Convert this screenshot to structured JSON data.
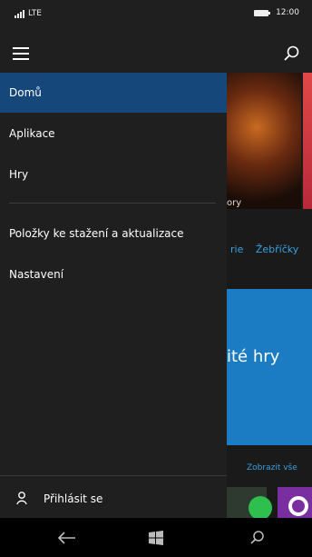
{
  "status_bar": {
    "network": "LTE",
    "time": "12:00"
  },
  "drawer": {
    "items": [
      {
        "label": "Domů",
        "active": true
      },
      {
        "label": "Aplikace"
      },
      {
        "label": "Hry"
      },
      {
        "label": "Položky ke stažení a aktualizace"
      },
      {
        "label": "Nastavení"
      }
    ],
    "signin_label": "Přihlásit se"
  },
  "background": {
    "tile_caption": "ory",
    "tab_1": "rie",
    "tab_2": "Žebříčky",
    "banner_text": "ité hry",
    "show_all": "Zobrazit vše"
  },
  "colors": {
    "accent": "#16477a",
    "link": "#3aa0e0",
    "drawer_bg": "#1f1f1f"
  },
  "icons": [
    "hamburger-icon",
    "search-icon",
    "person-icon",
    "back-icon",
    "windows-icon"
  ]
}
